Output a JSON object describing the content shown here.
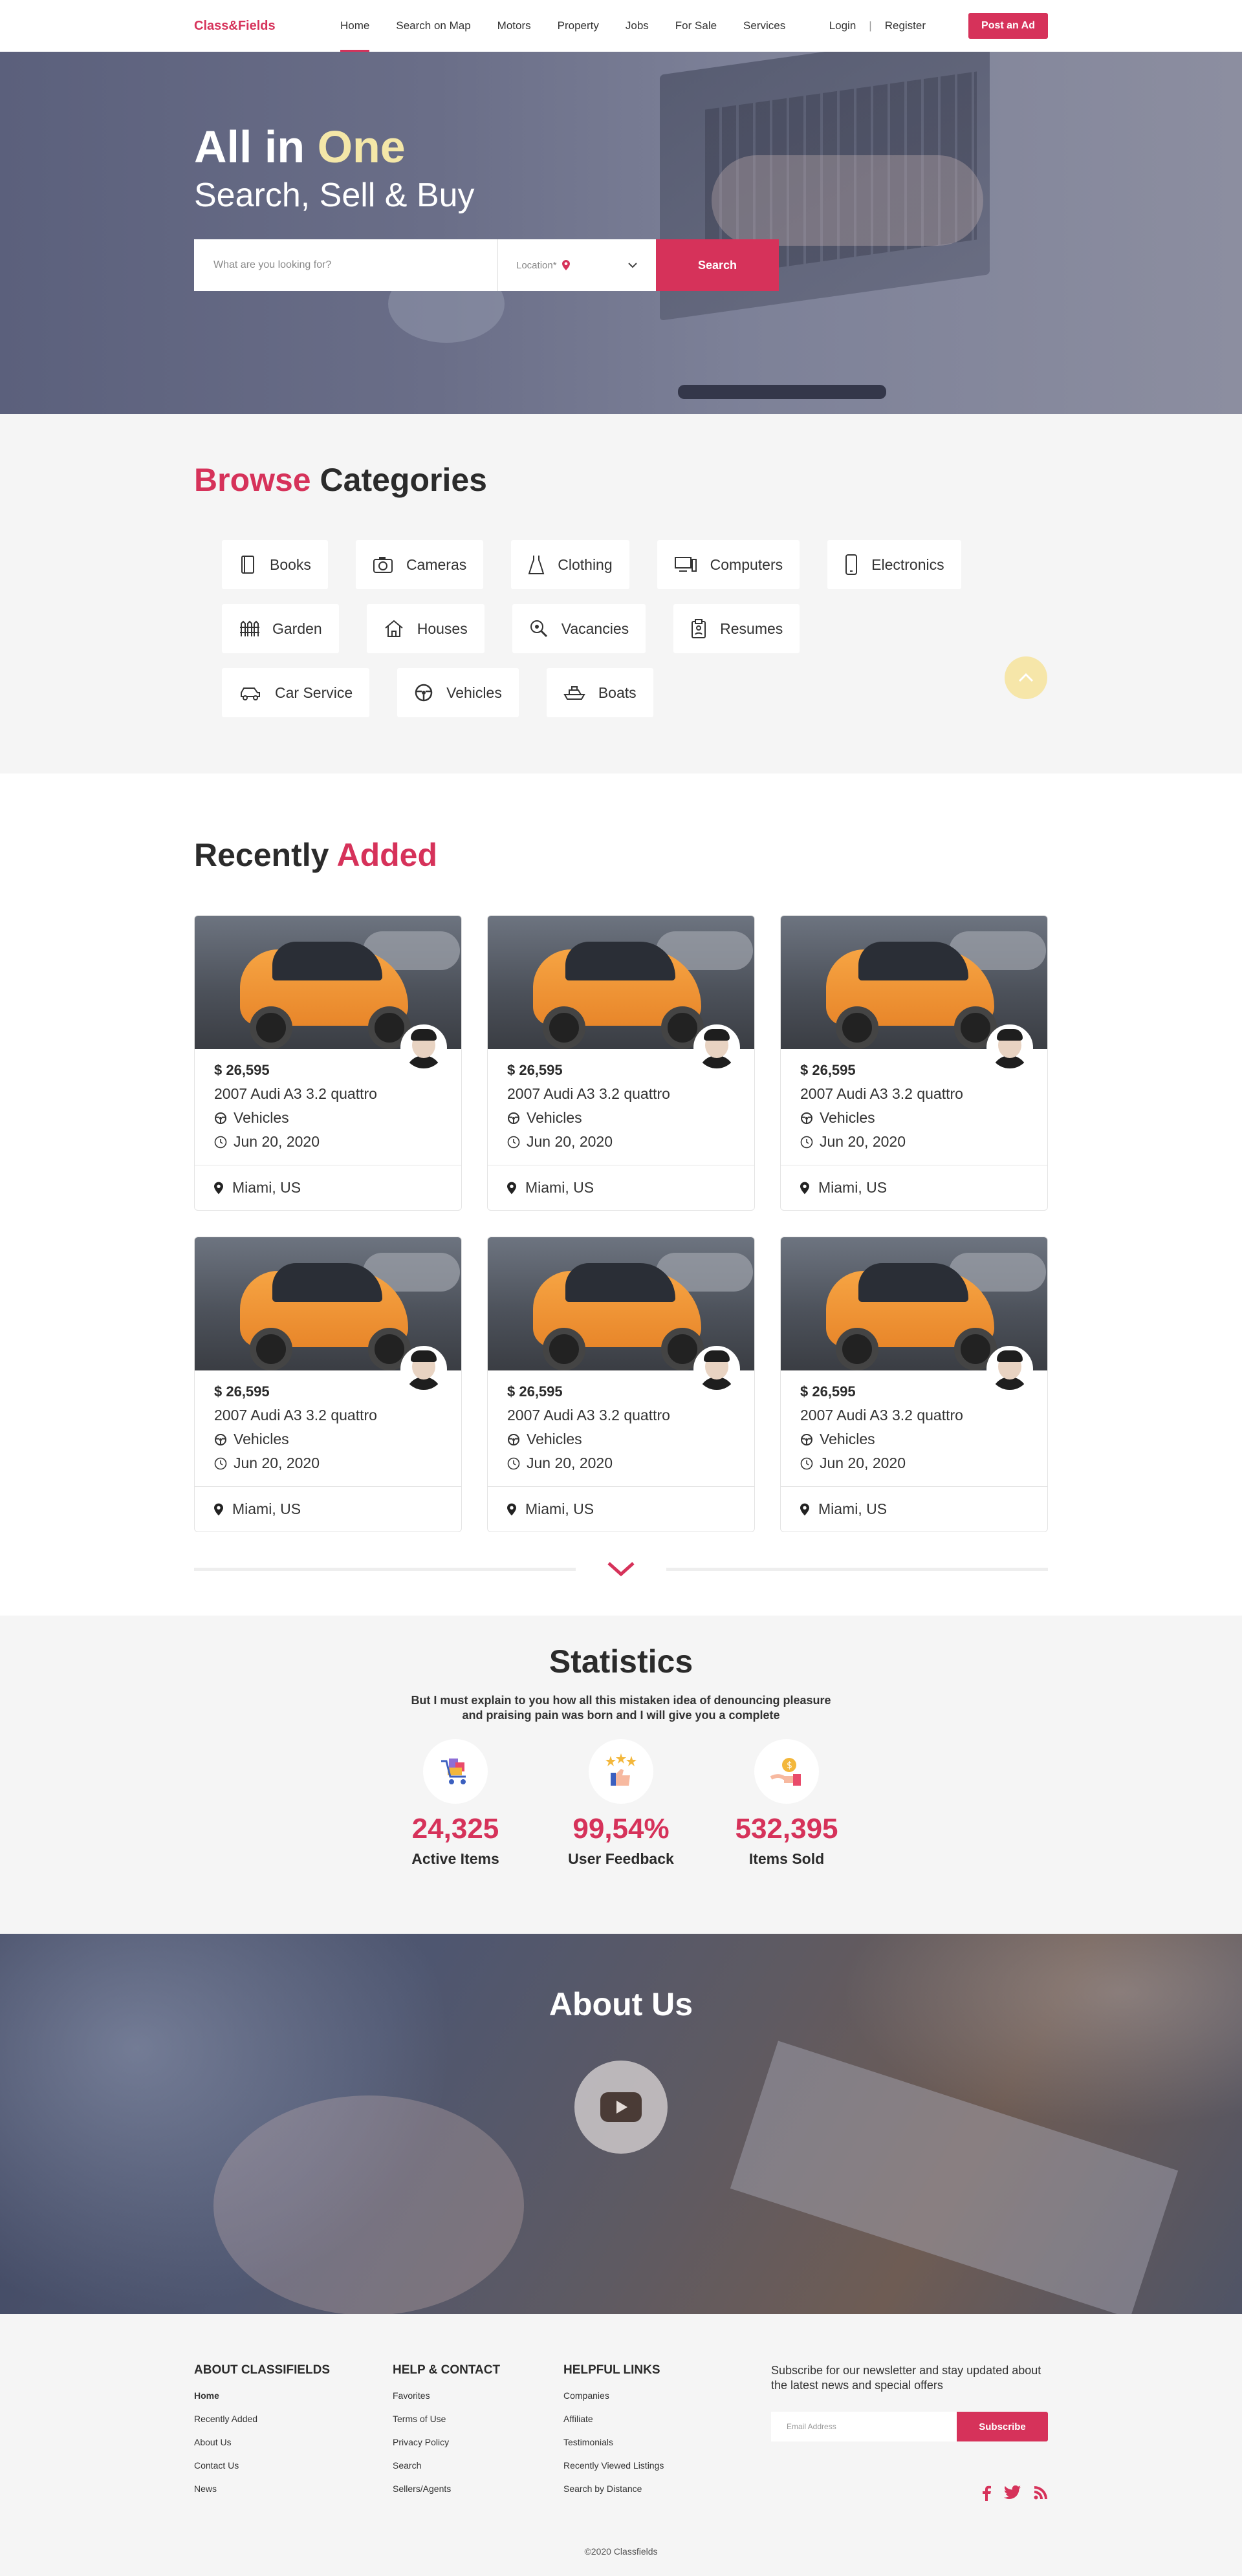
{
  "brand": {
    "logo": "Class&Fields",
    "accent": "#d6325a",
    "highlight": "#f4e7a8"
  },
  "nav": {
    "items": [
      {
        "label": "Home",
        "active": true
      },
      {
        "label": "Search on Map"
      },
      {
        "label": "Motors"
      },
      {
        "label": "Property"
      },
      {
        "label": "Jobs"
      },
      {
        "label": "For Sale"
      },
      {
        "label": "Services"
      }
    ],
    "login": "Login",
    "separator": "|",
    "register": "Register",
    "post_ad": "Post an Ad"
  },
  "hero": {
    "title_a": "All in",
    "title_b": "One",
    "subtitle": "Search, Sell & Buy",
    "search_placeholder": "What are you looking for?",
    "location_label": "Location*",
    "search_button": "Search"
  },
  "categories": {
    "title_a": "Browse",
    "title_b": "Categories",
    "items": [
      {
        "label": "Books",
        "icon": "book-icon"
      },
      {
        "label": "Cameras",
        "icon": "camera-icon"
      },
      {
        "label": "Clothing",
        "icon": "dress-icon"
      },
      {
        "label": "Computers",
        "icon": "computer-icon"
      },
      {
        "label": "Electronics",
        "icon": "phone-icon"
      },
      {
        "label": "Garden",
        "icon": "fence-icon"
      },
      {
        "label": "Houses",
        "icon": "house-icon"
      },
      {
        "label": "Vacancies",
        "icon": "magnifier-icon"
      },
      {
        "label": "Resumes",
        "icon": "clipboard-icon"
      },
      {
        "label": "Car Service",
        "icon": "car-icon"
      },
      {
        "label": "Vehicles",
        "icon": "steering-wheel-icon"
      },
      {
        "label": "Boats",
        "icon": "boat-icon"
      }
    ]
  },
  "recent": {
    "title_a": "Recently",
    "title_b": "Added",
    "cards": [
      {
        "price": "$ 26,595",
        "title": "2007 Audi A3 3.2 quattro",
        "category": "Vehicles",
        "date": "Jun 20, 2020",
        "location": "Miami, US"
      },
      {
        "price": "$ 26,595",
        "title": "2007 Audi A3 3.2 quattro",
        "category": "Vehicles",
        "date": "Jun 20, 2020",
        "location": "Miami, US"
      },
      {
        "price": "$ 26,595",
        "title": "2007 Audi A3 3.2 quattro",
        "category": "Vehicles",
        "date": "Jun 20, 2020",
        "location": "Miami, US"
      },
      {
        "price": "$ 26,595",
        "title": "2007 Audi A3 3.2 quattro",
        "category": "Vehicles",
        "date": "Jun 20, 2020",
        "location": "Miami, US"
      },
      {
        "price": "$ 26,595",
        "title": "2007 Audi A3 3.2 quattro",
        "category": "Vehicles",
        "date": "Jun 20, 2020",
        "location": "Miami, US"
      },
      {
        "price": "$ 26,595",
        "title": "2007 Audi A3 3.2 quattro",
        "category": "Vehicles",
        "date": "Jun 20, 2020",
        "location": "Miami, US"
      }
    ]
  },
  "stats": {
    "title": "Statistics",
    "text": "But I must explain to you how all this mistaken idea of denouncing pleasure and praising pain was born and I will give you a complete",
    "items": [
      {
        "value": "24,325",
        "label": "Active Items",
        "icon": "shopping-cart-icon"
      },
      {
        "value": "99,54%",
        "label": "User Feedback",
        "icon": "thumbs-up-stars-icon"
      },
      {
        "value": "532,395",
        "label": "Items Sold",
        "icon": "hand-coin-icon"
      }
    ]
  },
  "about": {
    "title": "About Us",
    "play_icon": "youtube-play-icon"
  },
  "footer": {
    "col1": {
      "title": "ABOUT CLASSIFIELDS",
      "links": [
        "Home",
        "Recently Added",
        "About Us",
        "Contact Us",
        "News"
      ]
    },
    "col2": {
      "title": "HELP & CONTACT",
      "links": [
        "Favorites",
        "Terms of Use",
        "Privacy Policy",
        "Search",
        "Sellers/Agents"
      ]
    },
    "col3": {
      "title": "HELPFUL LINKS",
      "links": [
        "Companies",
        "Affiliate",
        "Testimonials",
        "Recently Viewed Listings",
        "Search by Distance"
      ]
    },
    "newsletter": {
      "text": "Subscribe for our newsletter and stay updated about the latest news and special offers",
      "placeholder": "Email Address",
      "button": "Subscribe"
    },
    "social": [
      "facebook-icon",
      "twitter-icon",
      "rss-icon"
    ],
    "copyright": "©2020 Classfields"
  }
}
